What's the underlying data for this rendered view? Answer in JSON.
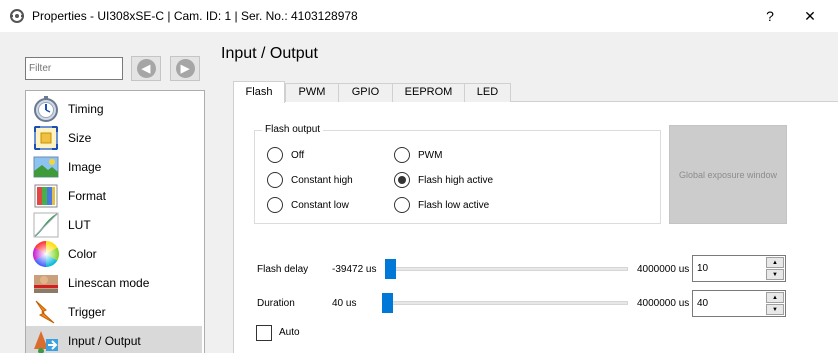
{
  "window": {
    "title": "Properties - UI308xSE-C | Cam. ID: 1 | Ser. No.: 4103128978",
    "help_label": "?",
    "close_label": "✕"
  },
  "sidebar": {
    "filter_placeholder": "Filter",
    "back_glyph": "◀",
    "forward_glyph": "▶",
    "items": [
      {
        "label": "Timing",
        "icon": "stopwatch-icon"
      },
      {
        "label": "Size",
        "icon": "resize-icon"
      },
      {
        "label": "Image",
        "icon": "image-icon"
      },
      {
        "label": "Format",
        "icon": "format-icon"
      },
      {
        "label": "LUT",
        "icon": "lut-curve-icon"
      },
      {
        "label": "Color",
        "icon": "color-wheel-icon"
      },
      {
        "label": "Linescan mode",
        "icon": "linescan-icon"
      },
      {
        "label": "Trigger",
        "icon": "trigger-icon"
      },
      {
        "label": "Input / Output",
        "icon": "input-output-icon",
        "selected": true
      }
    ]
  },
  "main": {
    "title": "Input / Output",
    "tabs": [
      {
        "label": "Flash",
        "active": true
      },
      {
        "label": "PWM"
      },
      {
        "label": "GPIO"
      },
      {
        "label": "EEPROM"
      },
      {
        "label": "LED"
      }
    ],
    "flash_output": {
      "title": "Flash output",
      "options": [
        {
          "label": "Off",
          "checked": false
        },
        {
          "label": "Constant high",
          "checked": false
        },
        {
          "label": "Constant low",
          "checked": false
        },
        {
          "label": "PWM",
          "checked": false
        },
        {
          "label": "Flash high active",
          "checked": true
        },
        {
          "label": "Flash low active",
          "checked": false
        }
      ]
    },
    "global_exposure_button": "Global exposure window",
    "flash_delay": {
      "label": "Flash delay",
      "min_label": "-39472 us",
      "max_label": "4000000 us",
      "value": "10"
    },
    "duration": {
      "label": "Duration",
      "min_label": "40 us",
      "max_label": "4000000 us",
      "value": "40"
    },
    "auto": {
      "label": "Auto",
      "checked": false
    },
    "colors": {
      "slider_thumb": "#0078d7",
      "selected_item": "#d9d9d9",
      "disabled_button": "#cccccc"
    }
  }
}
